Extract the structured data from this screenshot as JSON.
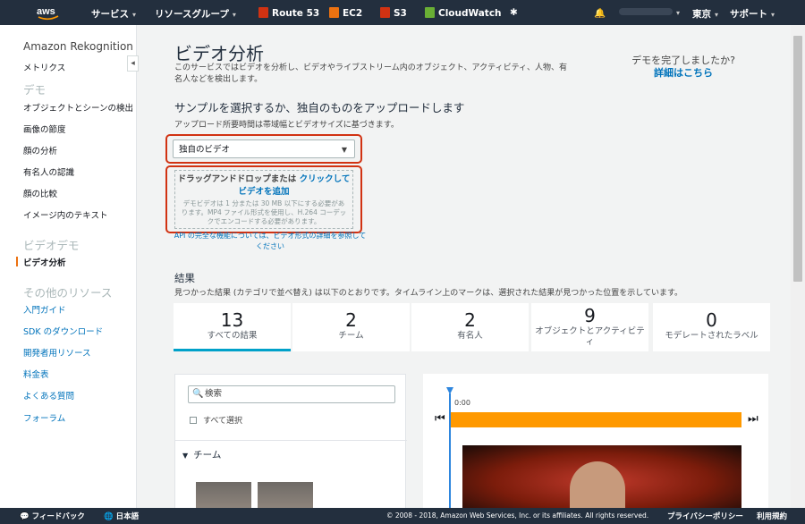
{
  "topnav": {
    "logo": "aws",
    "services": "サービス",
    "resource_groups": "リソースグループ",
    "route53": "Route 53",
    "ec2": "EC2",
    "s3": "S3",
    "cloudwatch": "CloudWatch",
    "region": "東京",
    "support": "サポート",
    "colors": {
      "route53": "#d13212",
      "ec2": "#ec7211",
      "s3": "#d13212",
      "cloudwatch": "#6aaf35"
    }
  },
  "sidebar": {
    "title": "Amazon Rekognition",
    "metrics": "メトリクス",
    "demo_section": "デモ",
    "demo_items": [
      "オブジェクトとシーンの検出",
      "画像の節度",
      "顔の分析",
      "有名人の認識",
      "顔の比較",
      "イメージ内のテキスト"
    ],
    "video_section": "ビデオデモ",
    "video_active": "ビデオ分析",
    "other_section": "その他のリソース",
    "other_items": [
      "入門ガイド",
      "SDK のダウンロード",
      "開発者用リソース",
      "料金表",
      "よくある質問",
      "フォーラム"
    ]
  },
  "main": {
    "title": "ビデオ分析",
    "description": "このサービスではビデオを分析し、ビデオやライブストリーム内のオブジェクト、アクティビティ、人物、有名人などを検出します。",
    "demo_question": "デモを完了しましたか?",
    "demo_link": "詳細はこちら",
    "sample_heading": "サンプルを選択するか、独自のものをアップロードします",
    "upload_note": "アップロード所要時間は帯域幅とビデオサイズに基づきます。",
    "select_value": "独自のビデオ",
    "drop_text": "ドラッグアンドドロップまたは",
    "drop_click": "クリックして",
    "drop_add": "ビデオを追加",
    "drop_note": "デモビデオは 1 分または 30 MB 以下にする必要があります。MP4 ファイル形式を使用し、H.264 コーデックでエンコードする必要があります。",
    "api_note": "API の完全な機能については、ビデオ形式の詳細を参照してください",
    "results_heading": "結果",
    "results_desc": "見つかった結果 (カテゴリで並べ替え) は以下のとおりです。タイムライン上のマークは、選択された結果が見つかった位置を示しています。",
    "tiles": [
      {
        "num": "13",
        "label": "すべての結果"
      },
      {
        "num": "2",
        "label": "チーム"
      },
      {
        "num": "2",
        "label": "有名人"
      },
      {
        "num": "9",
        "label": "オブジェクトとアクティビティ"
      },
      {
        "num": "0",
        "label": "モデレートされたラベル"
      }
    ],
    "search_placeholder": "検索",
    "select_all": "すべて選択",
    "team_heading": "チーム",
    "timeline_time": "0:00"
  },
  "footer": {
    "feedback": "フィードバック",
    "language": "日本語",
    "copyright": "© 2008 - 2018, Amazon Web Services, Inc. or its affiliates. All rights reserved.",
    "privacy": "プライバシーポリシー",
    "terms": "利用規約"
  }
}
